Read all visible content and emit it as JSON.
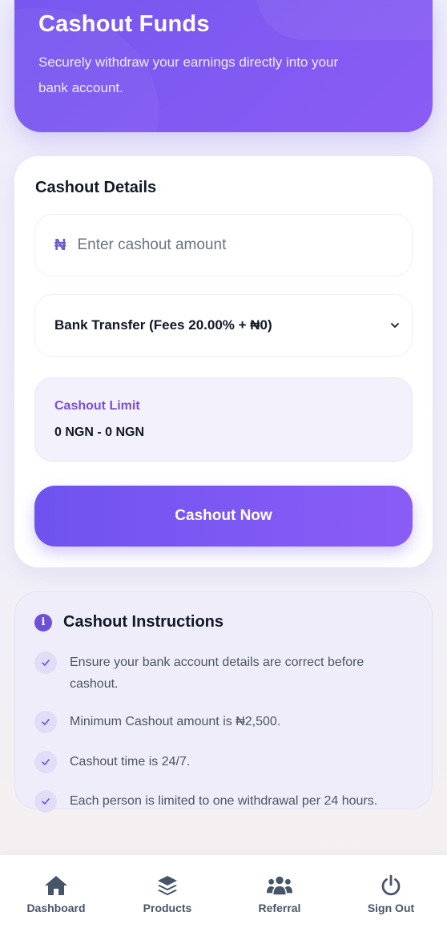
{
  "hero": {
    "title": "Cashout Funds",
    "subtitle": "Securely withdraw your earnings directly into your bank account."
  },
  "details": {
    "title": "Cashout Details",
    "amount_icon": "naira-icon",
    "amount_symbol": "₦",
    "amount_placeholder": "Enter cashout amount",
    "amount_value": "",
    "method_selected": "Bank Transfer (Fees 20.00% + ₦0)",
    "limit_label": "Cashout Limit",
    "limit_value": "0 NGN - 0 NGN",
    "button_label": "Cashout Now"
  },
  "instructions": {
    "title": "Cashout Instructions",
    "items": [
      "Ensure your bank account details are correct before cashout.",
      "Minimum Cashout amount is ₦2,500.",
      "Cashout time is 24/7.",
      "Each person is limited to one withdrawal per 24 hours."
    ]
  },
  "nav": {
    "items": [
      {
        "label": "Dashboard",
        "icon": "home-icon"
      },
      {
        "label": "Products",
        "icon": "layers-icon"
      },
      {
        "label": "Referral",
        "icon": "users-icon"
      },
      {
        "label": "Sign Out",
        "icon": "power-icon"
      }
    ]
  },
  "colors": {
    "accent": "#7657ef",
    "accent_light": "#8b5cf6",
    "limit_label": "#7b50d6",
    "nav_text": "#475569"
  }
}
